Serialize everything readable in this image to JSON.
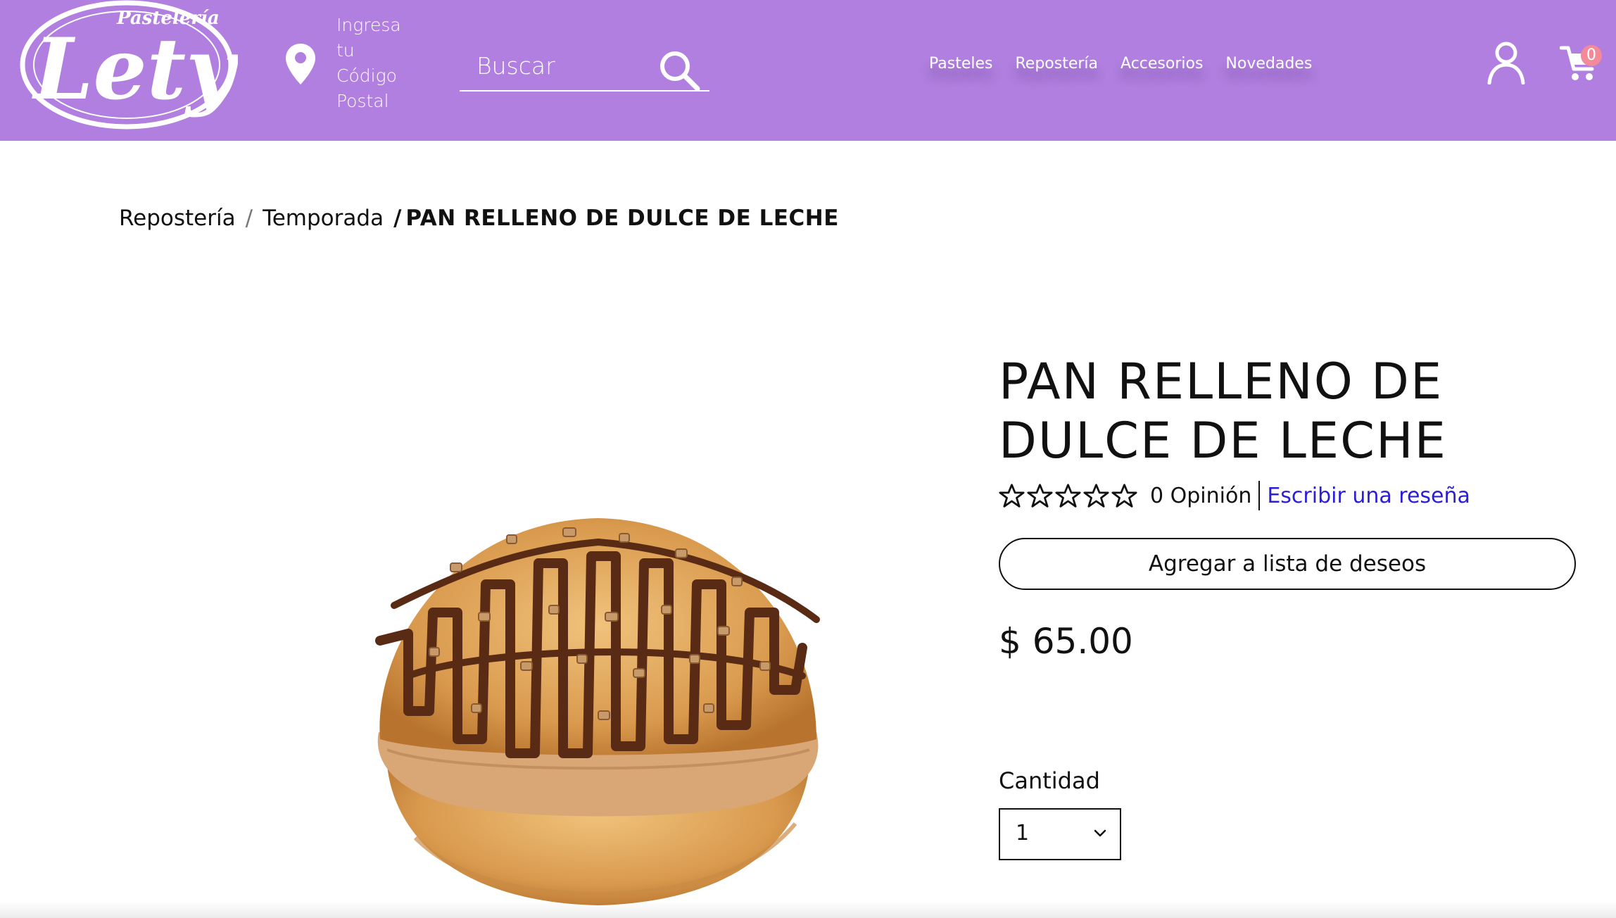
{
  "brand": {
    "logo_word": "Lety",
    "logo_tagline": "Pastelería"
  },
  "location": {
    "lines": [
      "Ingresa",
      "tu",
      "Código",
      "Postal"
    ]
  },
  "search": {
    "placeholder": "Buscar"
  },
  "nav": {
    "items": [
      "Pasteles",
      "Repostería",
      "Accesorios",
      "Novedades"
    ]
  },
  "cart": {
    "count": "0"
  },
  "breadcrumb": {
    "items": [
      "Repostería",
      "Temporada"
    ],
    "separator": "/",
    "current": "PAN RELLENO DE DULCE DE LECHE"
  },
  "product": {
    "title_line1": "PAN RELLENO DE",
    "title_line2": "DULCE DE LECHE",
    "rating": 0,
    "reviews_label": "0 Opinión",
    "write_review": "Escribir una reseña",
    "wishlist": "Agregar a lista de deseos",
    "price": "$ 65.00",
    "quantity_label": "Cantidad",
    "quantity_value": "1"
  },
  "colors": {
    "header_bg": "#b07fdf",
    "link": "#2a1ed6",
    "badge": "#f28a9a"
  }
}
